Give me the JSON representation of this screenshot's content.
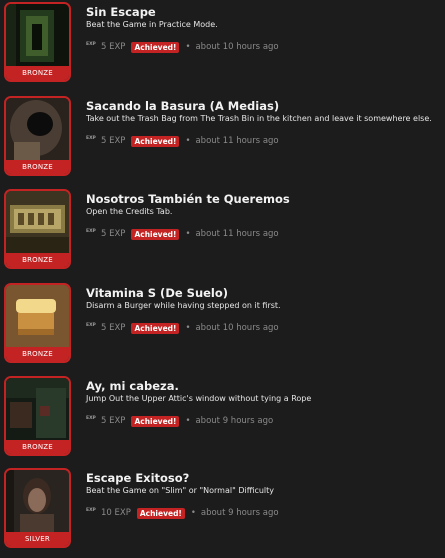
{
  "achievements": [
    {
      "title": "Sin Escape",
      "description": "Beat the Game in Practice Mode.",
      "exp_label": "EXP",
      "exp": "5 EXP",
      "status": "Achieved!",
      "time": "about 10 hours ago",
      "tier": "BRONZE",
      "thumb_icon": "dark-corridor-thumbnail"
    },
    {
      "title": "Sacando la Basura (A Medias)",
      "description": "Take out the Trash Bag from The Trash Bin in the kitchen and leave it somewhere else.",
      "exp_label": "EXP",
      "exp": "5 EXP",
      "status": "Achieved!",
      "time": "about 11 hours ago",
      "tier": "BRONZE",
      "thumb_icon": "trash-bag-thumbnail"
    },
    {
      "title": "Nosotros También te Queremos",
      "description": "Open the Credits Tab.",
      "exp_label": "EXP",
      "exp": "5 EXP",
      "status": "Achieved!",
      "time": "about 11 hours ago",
      "tier": "BRONZE",
      "thumb_icon": "sign-thumbnail"
    },
    {
      "title": "Vitamina S (De Suelo)",
      "description": "Disarm a Burger while having stepped on it first.",
      "exp_label": "EXP",
      "exp": "5 EXP",
      "status": "Achieved!",
      "time": "about 10 hours ago",
      "tier": "BRONZE",
      "thumb_icon": "burger-thumbnail"
    },
    {
      "title": "Ay, mi cabeza.",
      "description": "Jump Out the Upper Attic's window without tying a Rope",
      "exp_label": "EXP",
      "exp": "5 EXP",
      "status": "Achieved!",
      "time": "about 9 hours ago",
      "tier": "BRONZE",
      "thumb_icon": "attic-thumbnail"
    },
    {
      "title": "Escape Exitoso?",
      "description": "Beat the Game on \"Slim\" or \"Normal\" Difficulty",
      "exp_label": "EXP",
      "exp": "10 EXP",
      "status": "Achieved!",
      "time": "about 9 hours ago",
      "tier": "SILVER",
      "thumb_icon": "character-thumbnail"
    }
  ],
  "colors": {
    "background": "#1c1c1c",
    "accent": "#c42323",
    "muted": "#8a8a8a"
  }
}
